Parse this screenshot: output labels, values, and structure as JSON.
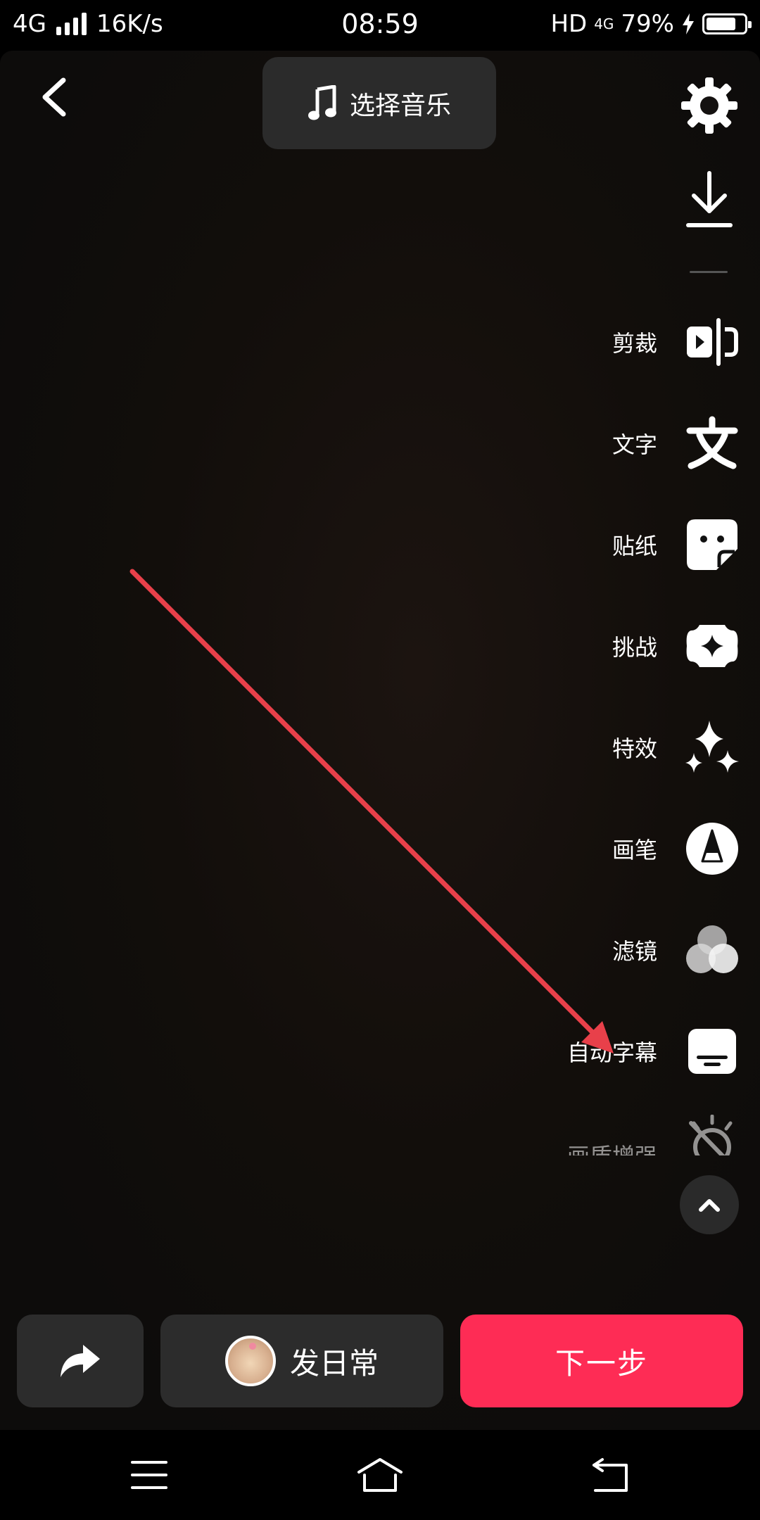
{
  "status_bar": {
    "network": "4G",
    "speed": "16K/s",
    "time": "08:59",
    "hd": "HD",
    "net2": "4G",
    "battery_percent": "79%",
    "battery_level": 0.79
  },
  "top": {
    "music_label": "选择音乐"
  },
  "tools": [
    {
      "label": "剪裁",
      "icon": "crop-icon"
    },
    {
      "label": "文字",
      "icon": "text-icon"
    },
    {
      "label": "贴纸",
      "icon": "sticker-icon"
    },
    {
      "label": "挑战",
      "icon": "challenge-icon"
    },
    {
      "label": "特效",
      "icon": "sparkle-icon"
    },
    {
      "label": "画笔",
      "icon": "brush-icon"
    },
    {
      "label": "滤镜",
      "icon": "filter-icon"
    },
    {
      "label": "自动字幕",
      "icon": "subtitle-icon"
    },
    {
      "label": "画质增强",
      "icon": "enhance-icon"
    }
  ],
  "bottom": {
    "daily_label": "发日常",
    "next_label": "下一步"
  },
  "colors": {
    "accent": "#fe2c55",
    "arrow": "#e8404a"
  }
}
